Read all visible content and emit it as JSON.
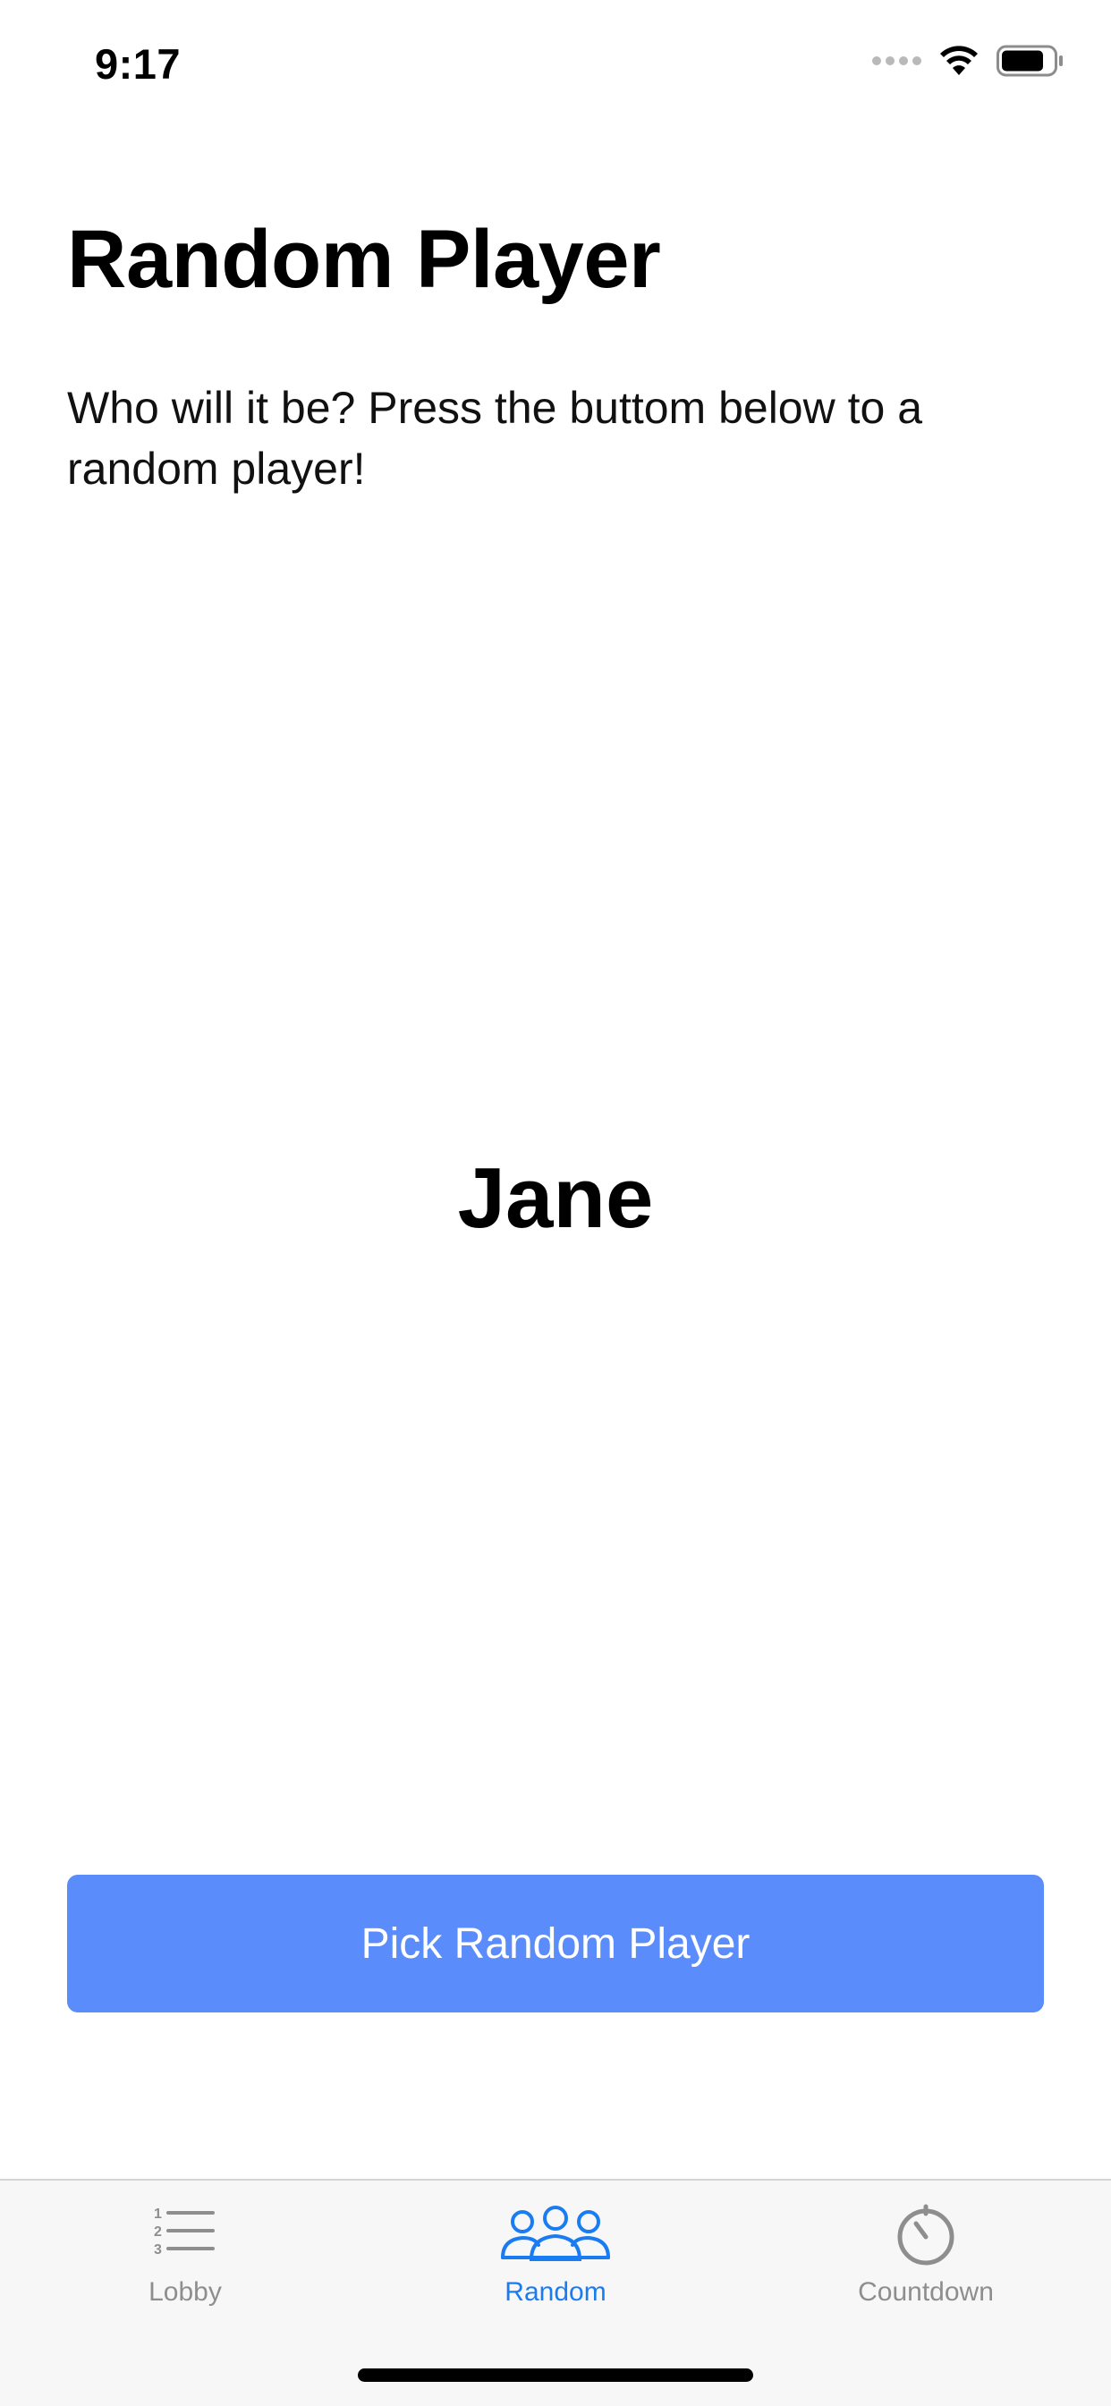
{
  "status_bar": {
    "time": "9:17"
  },
  "screen": {
    "title": "Random Player",
    "subtitle": "Who will it be? Press the buttom below to a random player!",
    "selected_player": "Jane",
    "pick_button_label": "Pick Random Player"
  },
  "tabs": [
    {
      "label": "Lobby",
      "icon": "numbered-list-icon",
      "active": false
    },
    {
      "label": "Random",
      "icon": "people-group-icon",
      "active": true
    },
    {
      "label": "Countdown",
      "icon": "timer-icon",
      "active": false
    }
  ],
  "colors": {
    "accent": "#5b8cfb",
    "tab_active": "#1a7cf2",
    "tab_inactive": "#8e8e8e"
  }
}
